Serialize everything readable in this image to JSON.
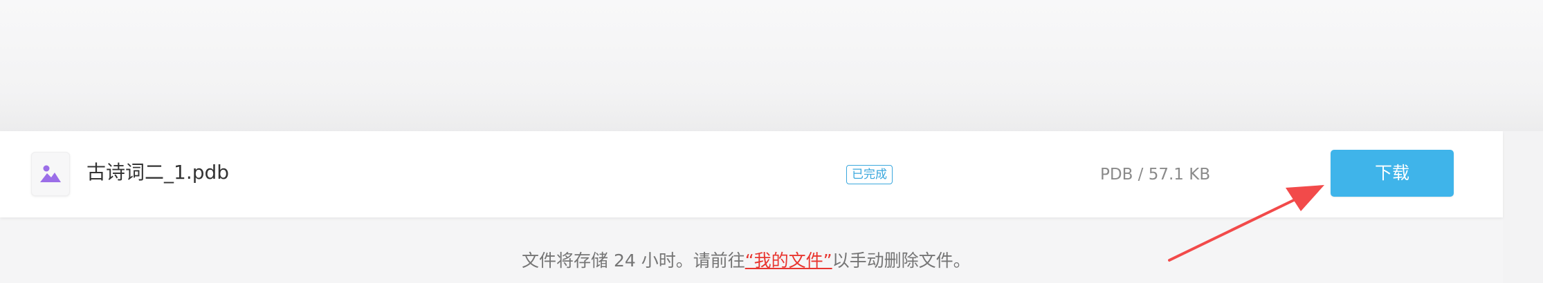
{
  "file": {
    "name": "古诗词二_1.pdb",
    "status": "已完成",
    "meta": "PDB / 57.1 KB",
    "icon": "image-icon"
  },
  "actions": {
    "download_label": "下载"
  },
  "notice": {
    "before": "文件将存储 24 小时。请前往",
    "link": "“我的文件”",
    "after": "以手动删除文件。"
  },
  "colors": {
    "accent": "#3fb4ea",
    "status": "#3aa7dd",
    "link": "#e8352f",
    "annotation_arrow": "#f24a4a",
    "icon": "#9b6ee8"
  }
}
